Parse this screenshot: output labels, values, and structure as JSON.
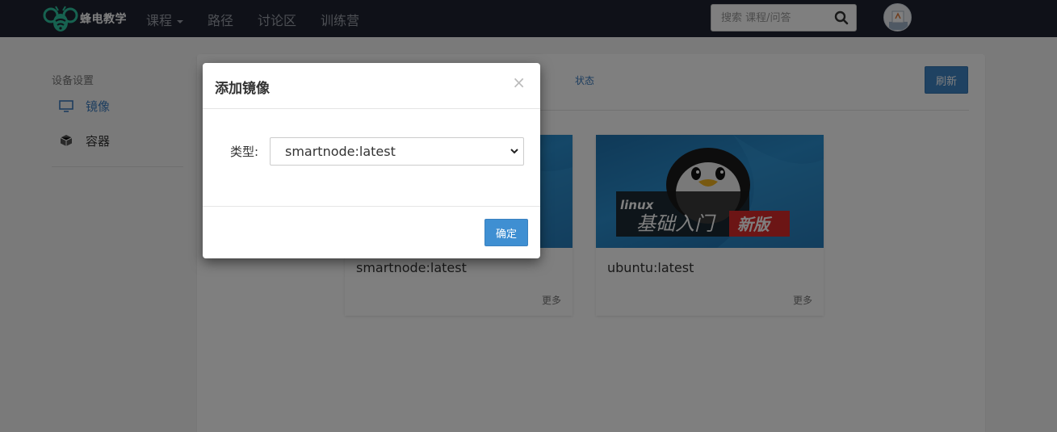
{
  "navbar": {
    "brand": "蜂电教学",
    "items": [
      {
        "label": "课程",
        "has_caret": true
      },
      {
        "label": "路径"
      },
      {
        "label": "讨论区"
      },
      {
        "label": "训练营"
      }
    ],
    "search_placeholder": "搜索 课程/问答"
  },
  "sidebar": {
    "title": "设备设置",
    "items": [
      {
        "label": "镜像",
        "icon": "monitor-icon",
        "active": true
      },
      {
        "label": "容器",
        "icon": "cube-icon",
        "active": false
      }
    ]
  },
  "panel": {
    "tab_status": "状态",
    "refresh_label": "刷新",
    "cards": [
      {
        "title": "smartnode:latest",
        "more": "更多"
      },
      {
        "title": "ubuntu:latest",
        "more": "更多",
        "image_text_1": "linux",
        "image_text_2": "基础入门",
        "image_text_3": "新版"
      }
    ]
  },
  "modal": {
    "title": "添加镜像",
    "close": "×",
    "field_label": "类型:",
    "selected_value": "smartnode:latest",
    "confirm_label": "确定"
  },
  "colors": {
    "navbar_bg": "#1e2330",
    "accent": "#3f84c5",
    "active_link": "#3a7bbf"
  }
}
